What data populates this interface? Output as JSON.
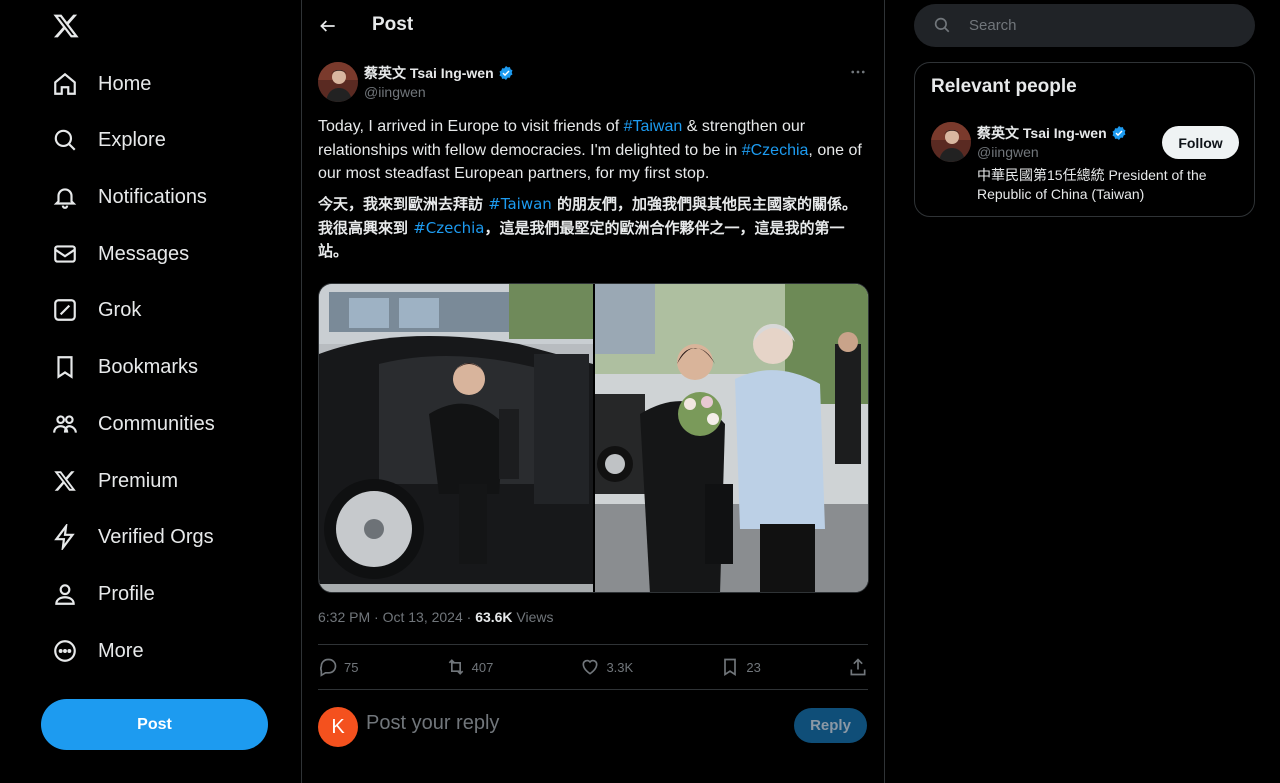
{
  "nav": {
    "items": [
      {
        "label": "Home",
        "icon": "home-icon"
      },
      {
        "label": "Explore",
        "icon": "search-icon"
      },
      {
        "label": "Notifications",
        "icon": "bell-icon"
      },
      {
        "label": "Messages",
        "icon": "envelope-icon"
      },
      {
        "label": "Grok",
        "icon": "grok-icon"
      },
      {
        "label": "Bookmarks",
        "icon": "bookmark-icon"
      },
      {
        "label": "Communities",
        "icon": "people-icon"
      },
      {
        "label": "Premium",
        "icon": "x-logo-icon"
      },
      {
        "label": "Verified Orgs",
        "icon": "lightning-icon"
      },
      {
        "label": "Profile",
        "icon": "person-icon"
      },
      {
        "label": "More",
        "icon": "more-circle-icon"
      }
    ],
    "post_button": "Post"
  },
  "header": {
    "title": "Post"
  },
  "tweet": {
    "author_name": "蔡英文 Tsai Ing-wen",
    "author_handle": "@iingwen",
    "text_en": {
      "p1": "Today, I arrived in Europe to visit friends of ",
      "tag1": "#Taiwan",
      "p2": " & strengthen our relationships with fellow democracies. I'm delighted to be in ",
      "tag2": "#Czechia",
      "p3": ", one of our most steadfast European partners, for my first stop."
    },
    "text_zh": {
      "p1": "今天，我來到歐洲去拜訪 ",
      "tag1": "#Taiwan",
      "p2": " 的朋友們，加強我們與其他民主國家的關係。我很高興來到 ",
      "tag2": "#Czechia",
      "p3": "，這是我們最堅定的歐洲合作夥伴之一，這是我的第一站。"
    },
    "timestamp": "6:32 PM · Oct 13, 2024 · ",
    "views_count": "63.6K",
    "views_label": " Views",
    "stats": {
      "replies": "75",
      "reposts": "407",
      "likes": "3.3K",
      "bookmarks": "23"
    }
  },
  "reply": {
    "avatar_letter": "K",
    "placeholder": "Post your reply",
    "button": "Reply"
  },
  "sidebar": {
    "search_placeholder": "Search",
    "relevant_title": "Relevant people",
    "person": {
      "name": "蔡英文 Tsai Ing-wen",
      "handle": "@iingwen",
      "bio": "中華民國第15任總統 President of the Republic of China (Taiwan)",
      "follow": "Follow"
    }
  },
  "colors": {
    "accent": "#1d9bf0",
    "background": "#000000",
    "border": "#2f3336",
    "muted": "#71767b",
    "verified": "#1d9bf0"
  }
}
